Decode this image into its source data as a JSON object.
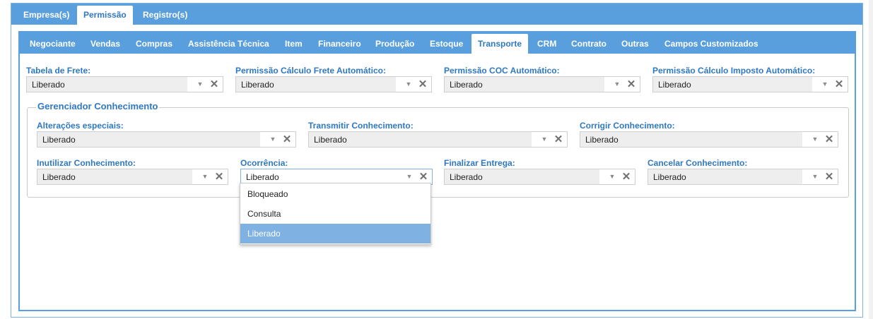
{
  "top_tabs": [
    "Empresa(s)",
    "Permissão",
    "Registro(s)"
  ],
  "sub_tabs": [
    "Negociante",
    "Vendas",
    "Compras",
    "Assistência Técnica",
    "Item",
    "Financeiro",
    "Produção",
    "Estoque",
    "Transporte",
    "CRM",
    "Contrato",
    "Outras",
    "Campos Customizados"
  ],
  "active_top_tab": "Permissão",
  "active_sub_tab": "Transporte",
  "fields": {
    "tabela_frete": {
      "label": "Tabela de Frete:",
      "value": "Liberado"
    },
    "calc_frete": {
      "label": "Permissão Cálculo Frete Automático:",
      "value": "Liberado"
    },
    "coc": {
      "label": "Permissão COC Automático:",
      "value": "Liberado"
    },
    "calc_imposto": {
      "label": "Permissão Cálculo Imposto Automático:",
      "value": "Liberado"
    }
  },
  "gerenciador": {
    "legend": "Gerenciador Conhecimento",
    "alteracoes": {
      "label": "Alterações especiais:",
      "value": "Liberado"
    },
    "transmitir": {
      "label": "Transmitir Conhecimento:",
      "value": "Liberado"
    },
    "corrigir": {
      "label": "Corrigir Conhecimento:",
      "value": "Liberado"
    },
    "inutilizar": {
      "label": "Inutilizar Conhecimento:",
      "value": "Liberado"
    },
    "ocorrencia": {
      "label": "Ocorrência:",
      "value": "Liberado"
    },
    "finalizar": {
      "label": "Finalizar Entrega:",
      "value": "Liberado"
    },
    "cancelar": {
      "label": "Cancelar Conhecimento:",
      "value": "Liberado"
    }
  },
  "dropdown_options": [
    "Bloqueado",
    "Consulta",
    "Liberado"
  ],
  "dropdown_selected": "Liberado",
  "icons": {
    "arrow": "chevron-down-icon",
    "clear": "close-icon"
  },
  "colors": {
    "accent": "#5a9fdd",
    "label": "#2f78c2",
    "selected": "#7fb1e2"
  }
}
